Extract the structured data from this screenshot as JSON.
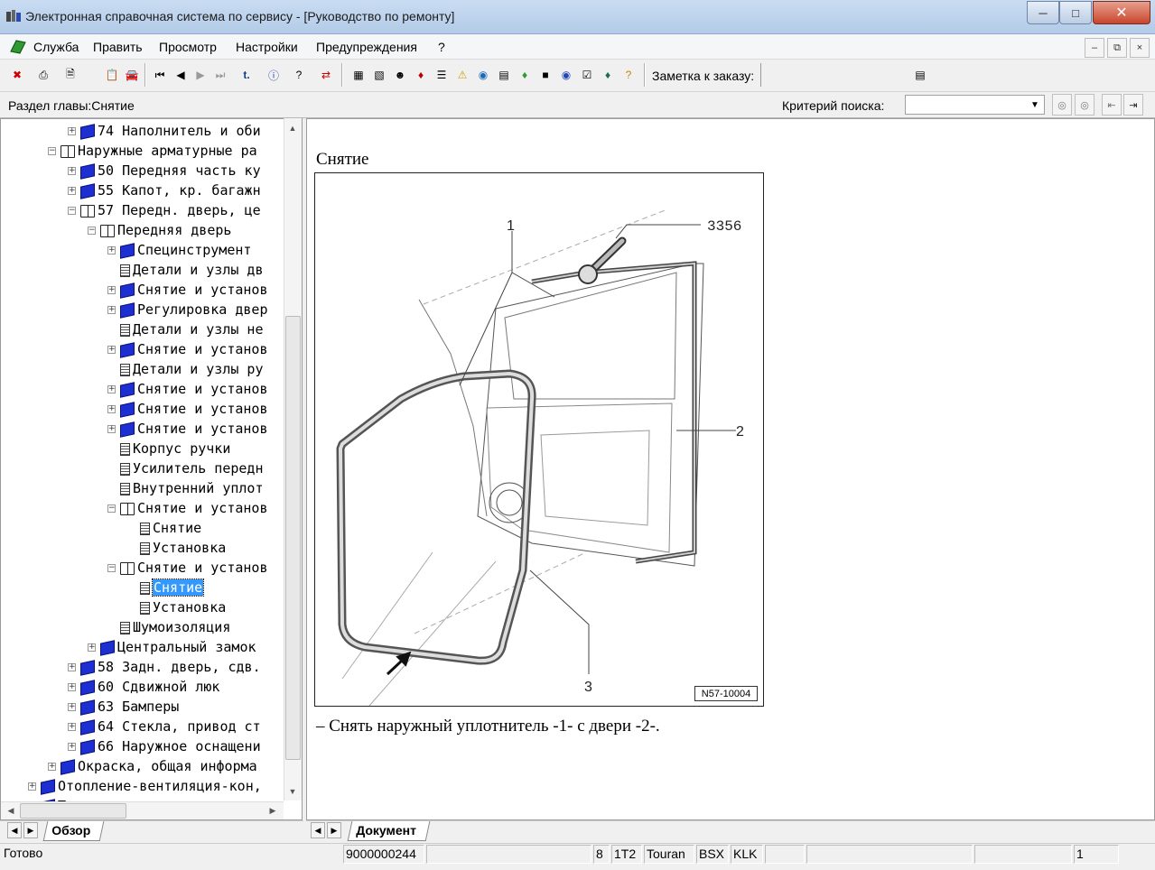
{
  "window": {
    "title": "Электронная справочная система по сервису - [Руководство по ремонту]",
    "minimize_icon": "minimize-icon",
    "maximize_icon": "maximize-icon",
    "close_icon": "close-icon"
  },
  "menu": {
    "items": [
      "Служба",
      "Править",
      "Просмотр",
      "Настройки",
      "Предупреждения",
      "?"
    ]
  },
  "toolbar": {
    "order_note_label": "Заметка к заказу:"
  },
  "addressbar": {
    "section_label": "Раздел главы:Снятие",
    "criteria_label": "Критерий  поиска:",
    "search_value": ""
  },
  "tree": {
    "items": [
      {
        "label": "74 Наполнитель и оби",
        "icon": "book-icon"
      },
      {
        "label": "Наружные арматурные ра",
        "icon": "open-book-icon"
      },
      {
        "label": "50 Передняя часть ку",
        "icon": "book-icon"
      },
      {
        "label": "55 Капот, кр. багажн",
        "icon": "book-icon"
      },
      {
        "label": "57 Передн. дверь, це",
        "icon": "open-book-icon"
      },
      {
        "label": "Передняя дверь",
        "icon": "open-book-icon"
      },
      {
        "label": "Специнструмент",
        "icon": "book-icon"
      },
      {
        "label": "Детали и узлы дв",
        "icon": "document-icon"
      },
      {
        "label": "Снятие и установ",
        "icon": "book-icon"
      },
      {
        "label": "Регулировка двер",
        "icon": "book-icon"
      },
      {
        "label": "Детали и узлы не",
        "icon": "document-icon"
      },
      {
        "label": "Снятие и установ",
        "icon": "book-icon"
      },
      {
        "label": "Детали и узлы ру",
        "icon": "document-icon"
      },
      {
        "label": "Снятие и установ",
        "icon": "book-icon"
      },
      {
        "label": "Снятие и установ",
        "icon": "book-icon"
      },
      {
        "label": "Снятие и установ",
        "icon": "book-icon"
      },
      {
        "label": "Корпус ручки",
        "icon": "document-icon"
      },
      {
        "label": "Усилитель передн",
        "icon": "document-icon"
      },
      {
        "label": "Внутренний уплот",
        "icon": "document-icon"
      },
      {
        "label": "Снятие и установ",
        "icon": "open-book-icon"
      },
      {
        "label": "Снятие",
        "icon": "document-icon"
      },
      {
        "label": "Установка",
        "icon": "document-icon"
      },
      {
        "label": "Снятие и установ",
        "icon": "open-book-icon"
      },
      {
        "label": "Снятие",
        "icon": "document-icon"
      },
      {
        "label": "Установка",
        "icon": "document-icon"
      },
      {
        "label": "Шумоизоляция",
        "icon": "document-icon"
      },
      {
        "label": "Центральный замок",
        "icon": "book-icon"
      },
      {
        "label": "58 Задн. дверь, сдв.",
        "icon": "book-icon"
      },
      {
        "label": "60 Сдвижной люк",
        "icon": "book-icon"
      },
      {
        "label": "63 Бамперы",
        "icon": "book-icon"
      },
      {
        "label": "64 Стекла, привод ст",
        "icon": "book-icon"
      },
      {
        "label": "66 Наружное оснащени",
        "icon": "book-icon"
      },
      {
        "label": "Окраска, общая информа",
        "icon": "book-icon"
      },
      {
        "label": "Отопление-вентиляция-кон,",
        "icon": "book-icon"
      },
      {
        "label": "Трансмиссия",
        "icon": "book-icon"
      }
    ],
    "tab_label": "Обзор"
  },
  "document": {
    "heading": "Снятие",
    "figure": {
      "callouts": [
        "1",
        "3356",
        "2",
        "3"
      ],
      "code": "N57-10004"
    },
    "step": "–  Снять наружный уплотнитель -1- с двери -2-.",
    "tab_label": "Документ"
  },
  "status": {
    "ready": "Готово",
    "order_number": "9000000244",
    "cells": [
      "8",
      "1T2",
      "Touran",
      "BSX",
      "KLK"
    ],
    "page": "1"
  }
}
